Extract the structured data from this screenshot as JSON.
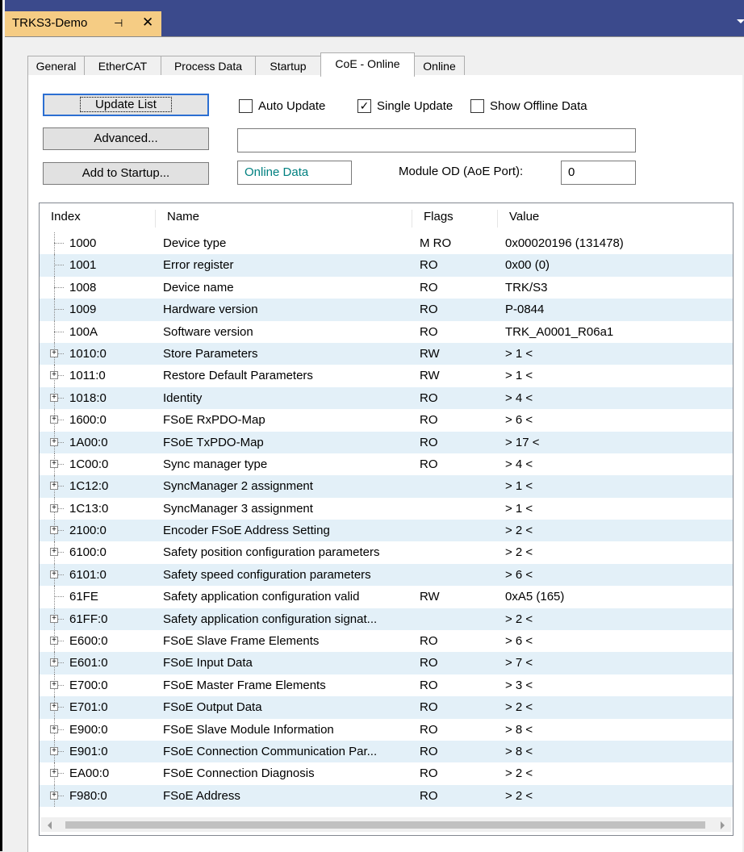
{
  "document_tab": {
    "title": "TRKS3-Demo",
    "pin_glyph": "⊣",
    "close_glyph": "✕"
  },
  "tabs": [
    "General",
    "EtherCAT",
    "Process Data",
    "Startup",
    "CoE - Online",
    "Online"
  ],
  "active_tab_index": 4,
  "buttons": {
    "update_list": "Update List",
    "advanced": "Advanced...",
    "add_to_startup": "Add to Startup..."
  },
  "checkboxes": {
    "auto_update": {
      "label": "Auto Update",
      "checked": false
    },
    "single_update": {
      "label": "Single Update",
      "checked": true
    },
    "show_offline_data": {
      "label": "Show Offline Data",
      "checked": false
    }
  },
  "advanced_textbox_value": "",
  "online_data_label": "Online Data",
  "module_od_label": "Module OD (AoE Port):",
  "module_od_value": "0",
  "table": {
    "columns": [
      "Index",
      "Name",
      "Flags",
      "Value"
    ],
    "rows": [
      {
        "index": "1000",
        "name": "Device type",
        "flags": "M RO",
        "value": "0x00020196 (131478)",
        "expandable": false
      },
      {
        "index": "1001",
        "name": "Error register",
        "flags": "RO",
        "value": "0x00 (0)",
        "expandable": false
      },
      {
        "index": "1008",
        "name": "Device name",
        "flags": "RO",
        "value": "TRK/S3",
        "expandable": false
      },
      {
        "index": "1009",
        "name": "Hardware version",
        "flags": "RO",
        "value": "P-0844",
        "expandable": false
      },
      {
        "index": "100A",
        "name": "Software version",
        "flags": "RO",
        "value": "TRK_A0001_R06a1",
        "expandable": false
      },
      {
        "index": "1010:0",
        "name": "Store Parameters",
        "flags": "RW",
        "value": "> 1 <",
        "expandable": true
      },
      {
        "index": "1011:0",
        "name": "Restore Default Parameters",
        "flags": "RW",
        "value": "> 1 <",
        "expandable": true
      },
      {
        "index": "1018:0",
        "name": "Identity",
        "flags": "RO",
        "value": "> 4 <",
        "expandable": true
      },
      {
        "index": "1600:0",
        "name": "FSoE RxPDO-Map",
        "flags": "RO",
        "value": "> 6 <",
        "expandable": true
      },
      {
        "index": "1A00:0",
        "name": "FSoE TxPDO-Map",
        "flags": "RO",
        "value": "> 17 <",
        "expandable": true
      },
      {
        "index": "1C00:0",
        "name": "Sync manager type",
        "flags": "RO",
        "value": "> 4 <",
        "expandable": true
      },
      {
        "index": "1C12:0",
        "name": "SyncManager 2 assignment",
        "flags": "",
        "value": "> 1 <",
        "expandable": true
      },
      {
        "index": "1C13:0",
        "name": "SyncManager 3 assignment",
        "flags": "",
        "value": "> 1 <",
        "expandable": true
      },
      {
        "index": "2100:0",
        "name": "Encoder FSoE Address Setting",
        "flags": "",
        "value": "> 2 <",
        "expandable": true
      },
      {
        "index": "6100:0",
        "name": "Safety position configuration parameters",
        "flags": "",
        "value": "> 2 <",
        "expandable": true
      },
      {
        "index": "6101:0",
        "name": "Safety speed configuration parameters",
        "flags": "",
        "value": "> 6 <",
        "expandable": true
      },
      {
        "index": "61FE",
        "name": "Safety application configuration valid",
        "flags": "RW",
        "value": "0xA5 (165)",
        "expandable": false
      },
      {
        "index": "61FF:0",
        "name": "Safety application configuration signat...",
        "flags": "",
        "value": "> 2 <",
        "expandable": true
      },
      {
        "index": "E600:0",
        "name": "FSoE Slave Frame Elements",
        "flags": "RO",
        "value": "> 6 <",
        "expandable": true
      },
      {
        "index": "E601:0",
        "name": "FSoE Input Data",
        "flags": "RO",
        "value": "> 7 <",
        "expandable": true
      },
      {
        "index": "E700:0",
        "name": "FSoE Master Frame Elements",
        "flags": "RO",
        "value": "> 3 <",
        "expandable": true
      },
      {
        "index": "E701:0",
        "name": "FSoE Output Data",
        "flags": "RO",
        "value": "> 2 <",
        "expandable": true
      },
      {
        "index": "E900:0",
        "name": "FSoE Slave Module Information",
        "flags": "RO",
        "value": "> 8 <",
        "expandable": true
      },
      {
        "index": "E901:0",
        "name": "FSoE Connection Communication Par...",
        "flags": "RO",
        "value": "> 8 <",
        "expandable": true
      },
      {
        "index": "EA00:0",
        "name": "FSoE Connection Diagnosis",
        "flags": "RO",
        "value": "> 2 <",
        "expandable": true
      },
      {
        "index": "F980:0",
        "name": "FSoE Address",
        "flags": "RO",
        "value": "> 2 <",
        "expandable": true
      }
    ]
  },
  "colors": {
    "header_bg": "#3b4a8c",
    "doc_tab_bg": "#f5cc84",
    "row_alt_bg": "#e3f0f8",
    "online_data_text": "#008080",
    "focus_border": "#2c6fd2"
  }
}
